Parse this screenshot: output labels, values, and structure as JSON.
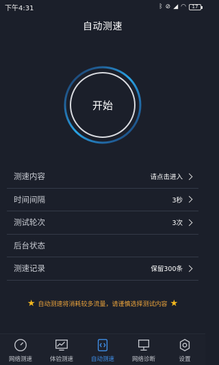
{
  "status_bar": {
    "time": "下午4:31",
    "battery": "17"
  },
  "header": {
    "title": "自动测速"
  },
  "start": {
    "label": "开始"
  },
  "settings": [
    {
      "label": "测速内容",
      "value": "请点击进入",
      "chevron": true
    },
    {
      "label": "时间间隔",
      "value": "3秒",
      "chevron": true
    },
    {
      "label": "测试轮次",
      "value": "3次",
      "chevron": true
    },
    {
      "label": "后台状态",
      "value": "",
      "chevron": false
    },
    {
      "label": "测速记录",
      "value": "保留300条",
      "chevron": true
    }
  ],
  "notice": {
    "text": "自动测速将消耗较多流量，请谨慎选择测试内容"
  },
  "tabs": [
    {
      "label": "网络测速",
      "icon": "speedometer-icon"
    },
    {
      "label": "体验测速",
      "icon": "monitor-chart-icon"
    },
    {
      "label": "自动测速",
      "icon": "auto-code-icon"
    },
    {
      "label": "网络诊断",
      "icon": "computer-icon"
    },
    {
      "label": "设置",
      "icon": "gear-icon"
    }
  ],
  "colors": {
    "background": "#1b1f2a",
    "accent": "#3f8fe8",
    "warning": "#e9a23b",
    "ring": "#2aa6e6"
  }
}
